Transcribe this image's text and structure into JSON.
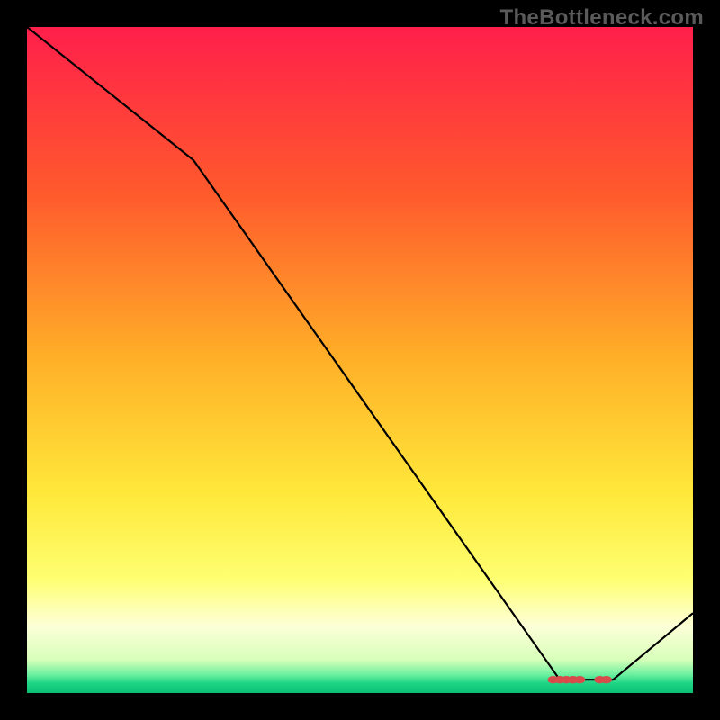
{
  "watermark": "TheBottleneck.com",
  "colors": {
    "bg": "#000000",
    "line": "#000000",
    "marker": "#d84b4b",
    "text": "#5a5a5a"
  },
  "chart_data": {
    "type": "line",
    "xlim": [
      0,
      100
    ],
    "ylim": [
      0,
      100
    ],
    "x": [
      0,
      25,
      80,
      88,
      100
    ],
    "y": [
      100,
      80,
      2,
      2,
      12
    ],
    "markers_x": [
      79,
      80,
      81,
      82,
      83,
      86,
      87
    ],
    "markers_y": [
      2,
      2,
      2,
      2,
      2,
      2,
      2
    ],
    "gradient_stops": [
      {
        "offset": 0.0,
        "color": "#ff1f4b"
      },
      {
        "offset": 0.25,
        "color": "#ff5a2c"
      },
      {
        "offset": 0.5,
        "color": "#ffb028"
      },
      {
        "offset": 0.7,
        "color": "#ffe83a"
      },
      {
        "offset": 0.83,
        "color": "#feff72"
      },
      {
        "offset": 0.9,
        "color": "#fdffd8"
      },
      {
        "offset": 0.95,
        "color": "#d8ffba"
      },
      {
        "offset": 0.972,
        "color": "#6df0a0"
      },
      {
        "offset": 0.985,
        "color": "#1fd585"
      },
      {
        "offset": 1.0,
        "color": "#0abf72"
      }
    ],
    "title": "",
    "xlabel": "",
    "ylabel": ""
  }
}
